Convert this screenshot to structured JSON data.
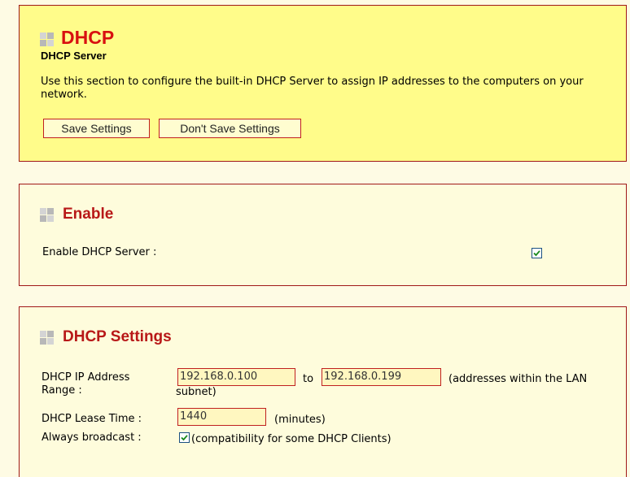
{
  "header": {
    "title": "DHCP",
    "subtitle": "DHCP Server",
    "description": "Use this section to configure the built-in DHCP Server to assign IP addresses to the computers on your network.",
    "save_label": "Save Settings",
    "dont_save_label": "Don't Save Settings"
  },
  "enable": {
    "title": "Enable",
    "label": "Enable DHCP Server :",
    "checked": true
  },
  "settings": {
    "title": "DHCP Settings",
    "range_label": "DHCP IP Address Range :",
    "range_start": "192.168.0.100",
    "to_text": "to",
    "range_end": "192.168.0.199",
    "range_note": "(addresses within the LAN subnet)",
    "lease_label": "DHCP Lease Time :",
    "lease_value": "1440",
    "lease_unit": "(minutes)",
    "broadcast_label": "Always broadcast :",
    "broadcast_checked": true,
    "broadcast_note": "(compatibility for some DHCP Clients)"
  },
  "colors": {
    "accent": "#d81010",
    "header_bg": "#fffc8a",
    "panel_bg": "#fefcdc",
    "border": "#a01818"
  }
}
